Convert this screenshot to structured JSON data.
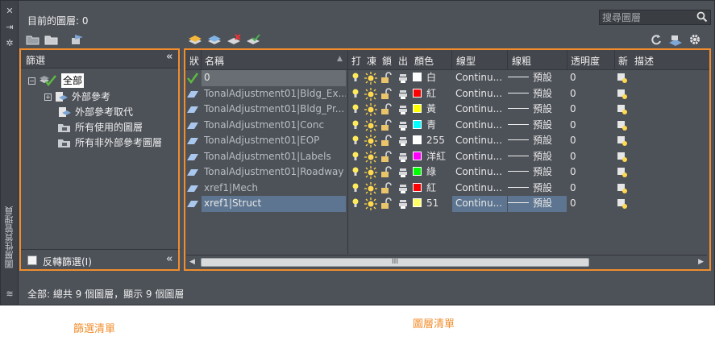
{
  "palette": {
    "current_layer": "目前的圖層: 0",
    "search_placeholder": "搜尋圖層",
    "side_title": "圖層性質管理員",
    "status": "全部: 總共 9 個圖層，顯示 9 個圖層"
  },
  "filter": {
    "header": "篩選",
    "collapse_glyph": "«",
    "tree": [
      {
        "label": "全部",
        "selected": true
      },
      {
        "label": "外部參考"
      },
      {
        "label": "外部參考取代"
      },
      {
        "label": "所有使用的圖層"
      },
      {
        "label": "所有非外部參考圖層"
      }
    ],
    "invert_label": "反轉篩選(I)"
  },
  "layers": {
    "columns": [
      "狀",
      "名稱",
      "打",
      "凍",
      "鎖",
      "出",
      "顏色",
      "線型",
      "線粗",
      "透明度",
      "新",
      "描述"
    ],
    "rows": [
      {
        "name": "0",
        "color_name": "白",
        "color": "#ffffff",
        "linetype": "Continu...",
        "lineweight": "預設",
        "transparency": "0",
        "current": true
      },
      {
        "name": "TonalAdjustment01|Bldg_Ex...",
        "color_name": "紅",
        "color": "#ff0000",
        "linetype": "Continu...",
        "lineweight": "預設",
        "transparency": "0"
      },
      {
        "name": "TonalAdjustment01|Bldg_Pr...",
        "color_name": "黃",
        "color": "#ffff00",
        "linetype": "Continu...",
        "lineweight": "預設",
        "transparency": "0"
      },
      {
        "name": "TonalAdjustment01|Conc",
        "color_name": "青",
        "color": "#00ffff",
        "linetype": "Continu...",
        "lineweight": "預設",
        "transparency": "0"
      },
      {
        "name": "TonalAdjustment01|EOP",
        "color_name": "255",
        "color": "#ffffff",
        "linetype": "Continu...",
        "lineweight": "預設",
        "transparency": "0"
      },
      {
        "name": "TonalAdjustment01|Labels",
        "color_name": "洋紅",
        "color": "#ff00ff",
        "linetype": "Continu...",
        "lineweight": "預設",
        "transparency": "0"
      },
      {
        "name": "TonalAdjustment01|Roadway",
        "color_name": "綠",
        "color": "#00ff00",
        "linetype": "Continu...",
        "lineweight": "預設",
        "transparency": "0"
      },
      {
        "name": "xref1|Mech",
        "color_name": "紅",
        "color": "#ff0000",
        "linetype": "Continu...",
        "lineweight": "預設",
        "transparency": "0"
      },
      {
        "name": "xref1|Struct",
        "color_name": "51",
        "color": "#ffff66",
        "linetype": "Continu...",
        "lineweight": "預設",
        "transparency": "0",
        "selected": true
      }
    ],
    "scroll_grip": "III"
  },
  "captions": {
    "filter_list": "篩選清單",
    "layer_list": "圖層清單"
  },
  "colors": {
    "accent": "#f18d2c",
    "panel": "#4d5158",
    "selection": "#5d7590"
  }
}
